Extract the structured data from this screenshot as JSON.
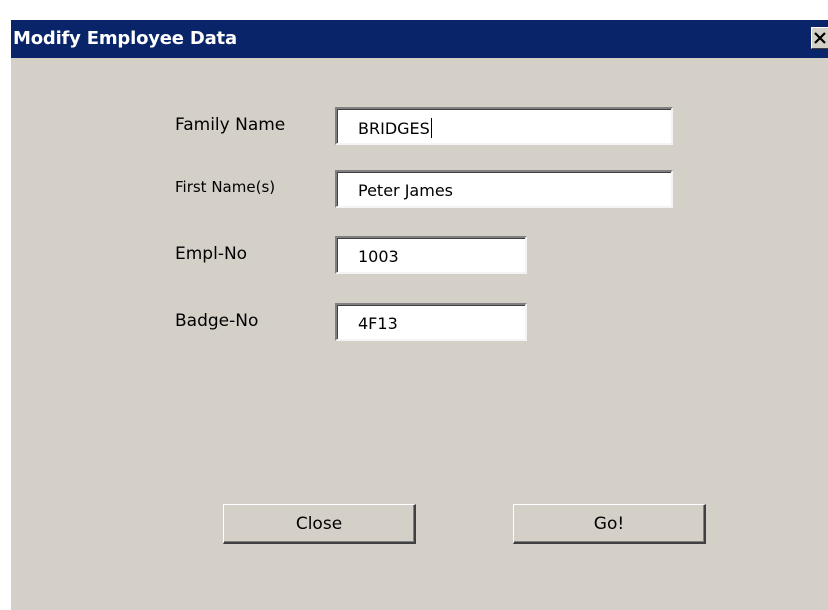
{
  "window": {
    "title": "Modify Employee Data",
    "close_icon": "close-icon"
  },
  "fields": {
    "family_name": {
      "label": "Family Name",
      "value": "BRIDGES"
    },
    "first_names": {
      "label": "First Name(s)",
      "value": "Peter James"
    },
    "empl_no": {
      "label": "Empl-No",
      "value": "1003"
    },
    "badge_no": {
      "label": "Badge-No",
      "value": "4F13"
    }
  },
  "buttons": {
    "close_label": "Close",
    "go_label": "Go!"
  },
  "colors": {
    "titlebar": "#0a246a",
    "dialog_face": "#d4d0c8"
  }
}
